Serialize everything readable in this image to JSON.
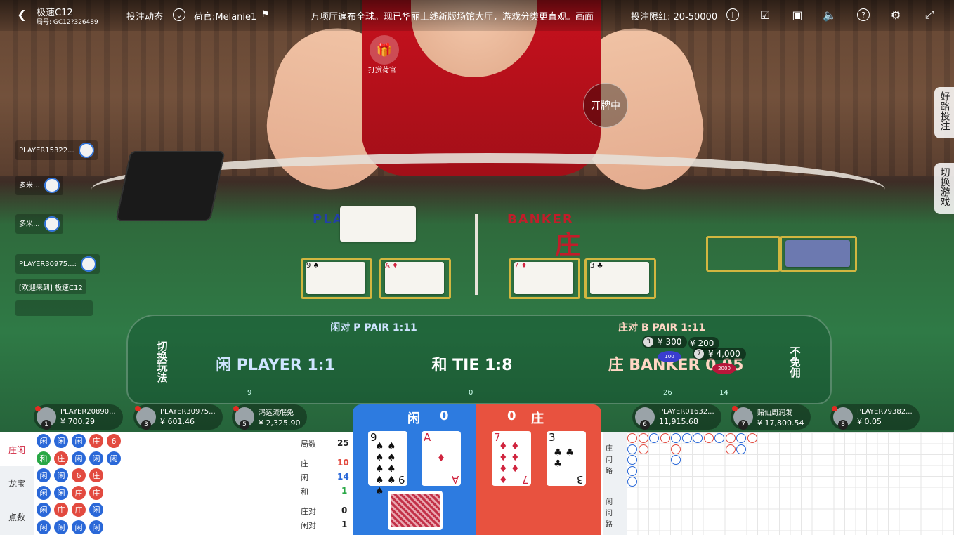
{
  "topbar": {
    "table_name": "极速C12",
    "round_id": "局号: GC12?326489",
    "bet_feed": "投注动态",
    "dealer": "荷官:Melanie1",
    "marquee": "万项厅遍布全球。现已华丽上线新版场馆大厅，游戏分类更直观。画面",
    "bet_limit": "投注限红: 20-50000"
  },
  "center": {
    "tip_dealer": "打赏荷官",
    "dealing": "开牌中"
  },
  "side_tabs": {
    "good_road": "好路投注",
    "switch_game": "切换游戏"
  },
  "chat": [
    {
      "name": "PLAYER15322..."
    },
    {
      "name": "多米..."
    },
    {
      "name": "多米..."
    },
    {
      "name": "PLAYER30975...:"
    },
    {
      "name": "[欢迎来到] 极速C12"
    }
  ],
  "felt": {
    "player": "PLAYER",
    "banker": "BANKER",
    "banker_cn": "庄",
    "player_pair": "闲对 P PAIR 1:11",
    "banker_pair": "庄对 B PAIR 1:11",
    "player_main": "闲 PLAYER 1:1",
    "tie_main": "和 TIE 1:8",
    "banker_main": "庄 BANKER 0.95",
    "switch_play": "切换玩法",
    "no_commission": "不免佣",
    "count_player": "9",
    "count_tie": "0",
    "count_banker": "26",
    "count_banker_2": "14"
  },
  "bets": [
    {
      "n": "3",
      "amount": "¥ 300"
    },
    {
      "n": "",
      "amount": "¥ 200"
    },
    {
      "n": "7",
      "amount": "¥ 4,000"
    }
  ],
  "players": [
    {
      "seat": "1",
      "name": "PLAYER20890...",
      "amount": "¥ 700.29"
    },
    {
      "seat": "3",
      "name": "PLAYER30975...",
      "amount": "¥ 601.46"
    },
    {
      "seat": "5",
      "name": "鸿运流氓兔",
      "amount": "¥ 2,325.90"
    },
    {
      "seat": "6",
      "name": "PLAYER01632...",
      "amount": "11,915.68"
    },
    {
      "seat": "7",
      "name": "赌仙周润发",
      "amount": "¥ 17,800.54"
    },
    {
      "seat": "8",
      "name": "PLAYER79382...",
      "amount": "¥ 0.05"
    }
  ],
  "left_tabs": [
    "庄闲",
    "龙宝",
    "点数"
  ],
  "stats": {
    "rounds_label": "局数",
    "rounds": "25",
    "banker_label": "庄",
    "banker": "10",
    "player_label": "闲",
    "player": "14",
    "tie_label": "和",
    "tie": "1",
    "bpair_label": "庄对",
    "bpair": "0",
    "ppair_label": "闲对",
    "ppair": "1"
  },
  "result": {
    "player_label": "闲",
    "player_score": "0",
    "banker_label": "庄",
    "banker_score": "0",
    "player_cards": [
      {
        "rank": "9",
        "suit": "♠"
      },
      {
        "rank": "A",
        "suit": "♦"
      }
    ],
    "banker_cards": [
      {
        "rank": "7",
        "suit": "♦"
      },
      {
        "rank": "3",
        "suit": "♣"
      }
    ]
  },
  "roadmap_labels": [
    "庄",
    "问",
    "路",
    "闲",
    "问",
    "路"
  ],
  "colors": {
    "player": "#2a68d8",
    "banker": "#e24a3f",
    "tie": "#28a745"
  }
}
